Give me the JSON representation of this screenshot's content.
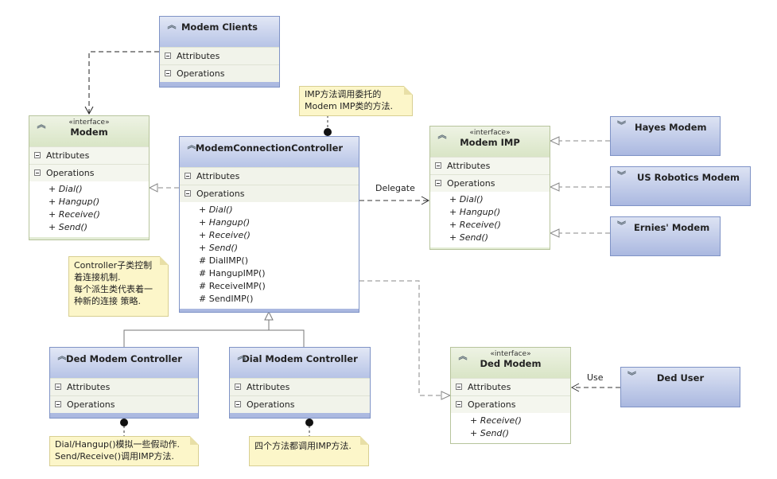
{
  "diagram": {
    "classes": {
      "modem_clients": {
        "name": "Modem Clients",
        "sections": [
          "Attributes",
          "Operations"
        ],
        "operations": []
      },
      "modem": {
        "stereotype": "«interface»",
        "name": "Modem",
        "sections": [
          "Attributes",
          "Operations"
        ],
        "operations": [
          "+ Dial()",
          "+ Hangup()",
          "+ Receive()",
          "+ Send()"
        ]
      },
      "controller": {
        "name": "ModemConnectionController",
        "sections": [
          "Attributes",
          "Operations"
        ],
        "operations": [
          "+ Dial()",
          "+ Hangup()",
          "+ Receive()",
          "+ Send()",
          "# DialIMP()",
          "# HangupIMP()",
          "# ReceiveIMP()",
          "# SendIMP()"
        ]
      },
      "modem_imp": {
        "stereotype": "«interface»",
        "name": "Modem IMP",
        "sections": [
          "Attributes",
          "Operations"
        ],
        "operations": [
          "+ Dial()",
          "+ Hangup()",
          "+ Receive()",
          "+ Send()"
        ]
      },
      "hayes": {
        "name": "Hayes Modem"
      },
      "us_robotics": {
        "name": "US Robotics Modem"
      },
      "ernies": {
        "name": "Ernies' Modem"
      },
      "ded_controller": {
        "name": "Ded Modem Controller",
        "sections": [
          "Attributes",
          "Operations"
        ]
      },
      "dial_controller": {
        "name": "Dial Modem Controller",
        "sections": [
          "Attributes",
          "Operations"
        ]
      },
      "ded_modem": {
        "stereotype": "«interface»",
        "name": "Ded Modem",
        "sections": [
          "Attributes",
          "Operations"
        ],
        "operations": [
          "+ Receive()",
          "+ Send()"
        ]
      },
      "ded_user": {
        "name": "Ded User"
      }
    },
    "notes": {
      "imp_note": [
        "IMP方法调用委托的",
        "Modem IMP类的方法."
      ],
      "controller_note": [
        "Controller子类控制",
        "着连接机制.",
        "每个派生类代表着一",
        "种新的连接 策略."
      ],
      "ded_note": [
        "Dial/Hangup()模拟一些假动作.",
        "Send/Receive()调用IMP方法."
      ],
      "dial_note": [
        "四个方法都调用IMP方法."
      ]
    },
    "labels": {
      "delegate": "Delegate",
      "use": "Use"
    }
  }
}
